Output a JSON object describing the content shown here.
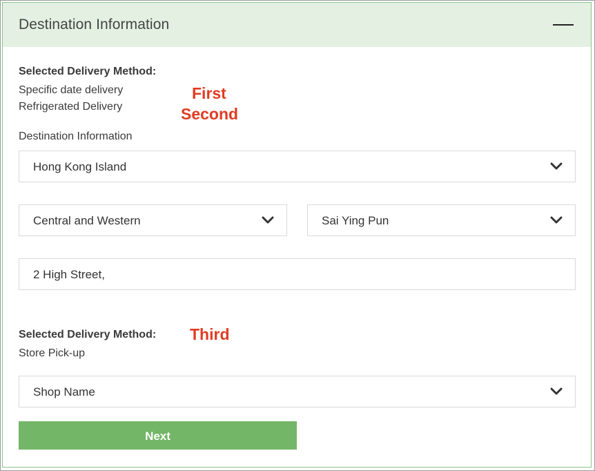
{
  "header": {
    "title": "Destination Information",
    "collapse_icon": "minus-icon"
  },
  "delivery_section_1": {
    "label": "Selected Delivery Method:",
    "methods": [
      "Specific date delivery",
      "Refrigerated Delivery"
    ],
    "annotations": [
      "First",
      "Second"
    ]
  },
  "destination": {
    "label": "Destination Information",
    "region": "Hong Kong Island",
    "district": "Central and Western",
    "area": "Sai Ying Pun",
    "address": "2 High Street,"
  },
  "delivery_section_2": {
    "label": "Selected Delivery Method:",
    "method": "Store Pick-up",
    "annotation": "Third",
    "shop_select": "Shop Name"
  },
  "next_button": {
    "label": "Next"
  },
  "colors": {
    "header_bg": "#e3f0e2",
    "accent_green": "#74b667",
    "annotation_red": "#e13b22"
  }
}
